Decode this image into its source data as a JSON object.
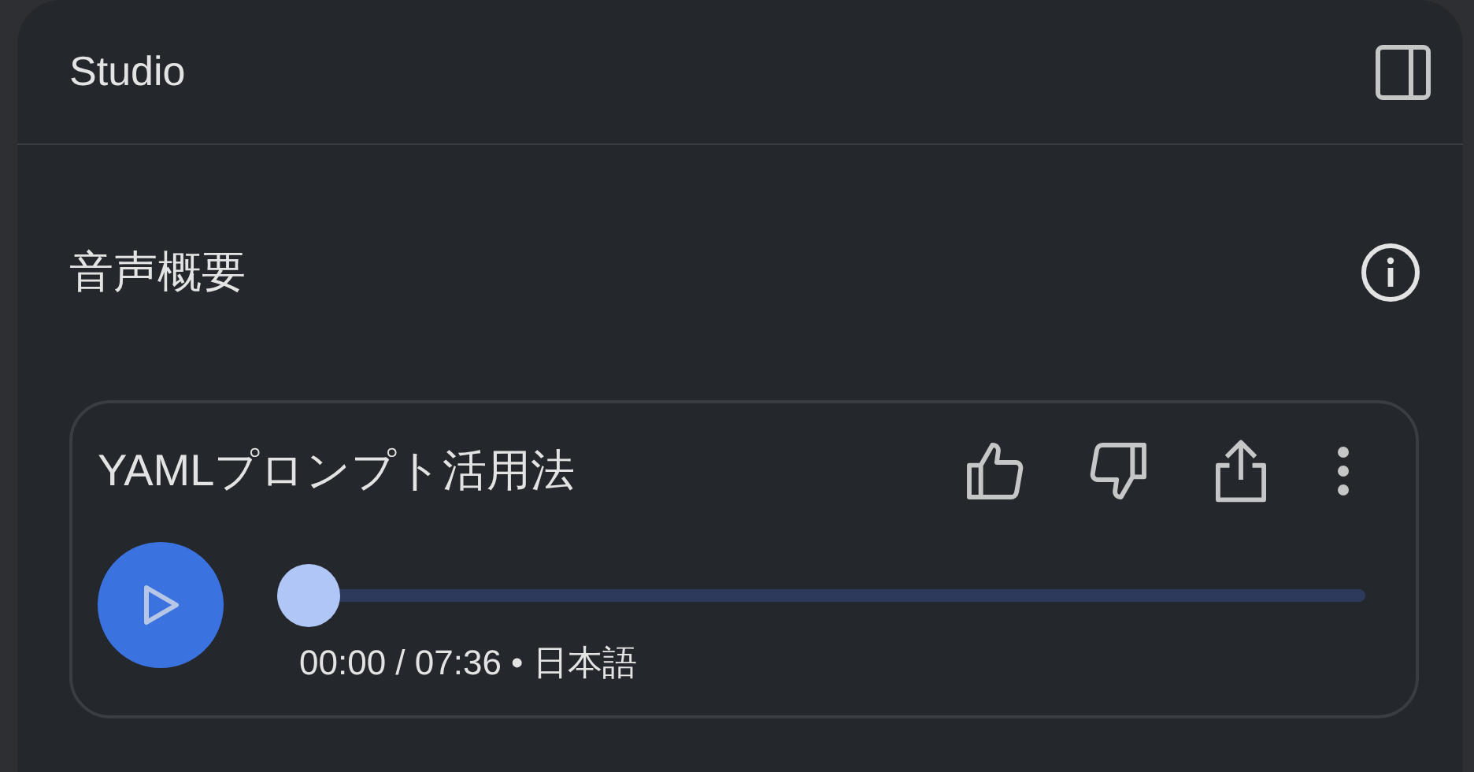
{
  "panel": {
    "title": "Studio"
  },
  "section": {
    "title": "音声概要"
  },
  "audio_overview": {
    "title": "YAMLプロンプト活用法",
    "level": 0,
    "time": "00:00 / 07:36 • 日本語"
  }
}
